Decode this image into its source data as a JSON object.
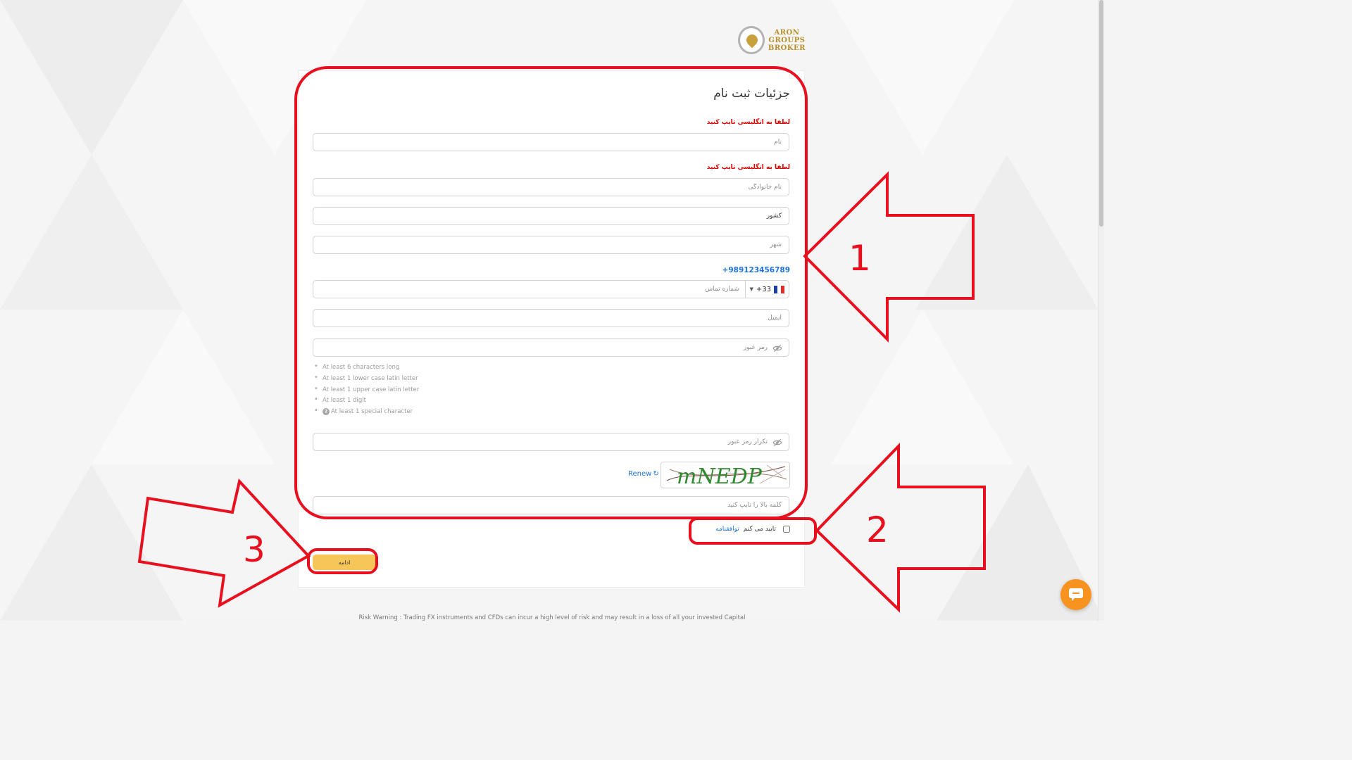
{
  "logo": {
    "line1": "ARON",
    "line2": "GROUPS",
    "line3": "BROKER"
  },
  "form": {
    "title": "جزئیات ثبت نام",
    "english_hint": "لطفا به انگلیسی تایپ کنید",
    "first_name_placeholder": "نام",
    "last_name_placeholder": "نام خانوادگی",
    "country_value": "کشور",
    "city_placeholder": "شهر",
    "phone_sample": "+989123456789",
    "dial_code": "+33",
    "phone_placeholder": "شماره تماس",
    "email_placeholder": "ایمیل",
    "password_placeholder": "رمز عبور",
    "password_rules": [
      "At least 6 characters long",
      "At least 1 lower case latin letter",
      "At least 1 upper case latin letter",
      "At least 1 digit",
      "At least 1 special character"
    ],
    "confirm_password_placeholder": "تکرار رمز عبور",
    "captcha_text": "mNEDP",
    "renew_label": "Renew",
    "captcha_placeholder": "کلمه بالا را تایپ کنید",
    "agree_label": "تایید می کنم",
    "agree_link": "توافقنامه",
    "submit_label": "ادامه"
  },
  "footer": {
    "risk_warning": "Risk Warning : Trading FX instruments and CFDs can incur a high level of risk and may result in a loss of all your invested Capital"
  },
  "annotations": {
    "label_1": "1",
    "label_2": "2",
    "label_3": "3"
  },
  "colors": {
    "annotation_red": "#e8101e",
    "button": "#f6c658",
    "link": "#1e73d8",
    "hint": "#e00000",
    "chat": "#f7931e"
  }
}
